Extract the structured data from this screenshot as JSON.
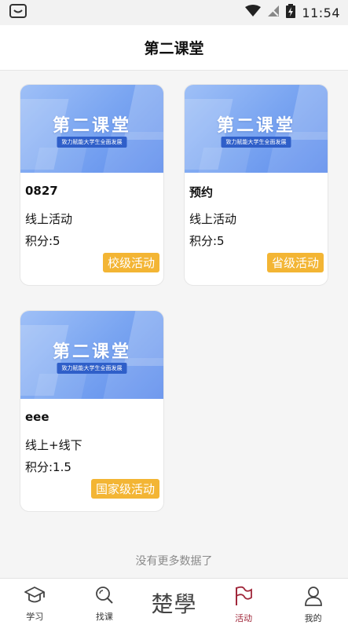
{
  "status_bar": {
    "time": "11:54"
  },
  "header": {
    "title": "第二课堂"
  },
  "cards": [
    {
      "banner_title": "第二课堂",
      "banner_subtitle": "致力赋能大学生全面发展",
      "name": "0827",
      "mode": "线上活动",
      "points": "积分:5",
      "tag": "校级活动"
    },
    {
      "banner_title": "第二课堂",
      "banner_subtitle": "致力赋能大学生全面发展",
      "name": "预约",
      "mode": "线上活动",
      "points": "积分:5",
      "tag": "省级活动"
    },
    {
      "banner_title": "第二课堂",
      "banner_subtitle": "致力赋能大学生全面发展",
      "name": "eee",
      "mode": "线上+线下",
      "points": "积分:1.5",
      "tag": "国家级活动"
    }
  ],
  "list_footer": "没有更多数据了",
  "nav": {
    "items": [
      {
        "label": "学习",
        "icon": "graduation-cap-icon"
      },
      {
        "label": "找课",
        "icon": "search-icon"
      },
      {
        "label": "楚學",
        "icon": "logo"
      },
      {
        "label": "活动",
        "icon": "flag-icon",
        "active": true
      },
      {
        "label": "我的",
        "icon": "user-icon"
      }
    ]
  },
  "colors": {
    "tag_bg": "#f3b534",
    "active_nav": "#a0273a",
    "banner_blue": "#7aa5f1"
  }
}
